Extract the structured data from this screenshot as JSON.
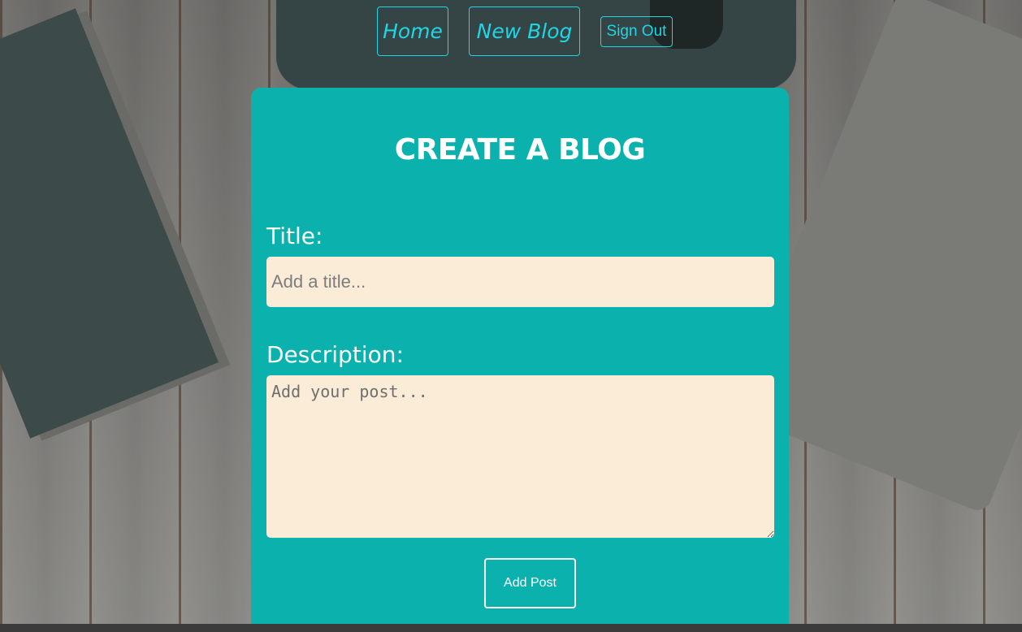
{
  "nav": {
    "home_label": "Home",
    "new_blog_label": "New Blog",
    "sign_out_label": "Sign Out"
  },
  "form": {
    "heading": "CREATE A BLOG",
    "title_label": "Title:",
    "title_placeholder": "Add a title...",
    "title_value": "",
    "description_label": "Description:",
    "description_placeholder": "Add your post...",
    "description_value": "",
    "submit_label": "Add Post"
  },
  "colors": {
    "card_background": "#0ab1ad",
    "nav_accent": "#1fd6e6",
    "input_background": "#fbecd8",
    "text_on_card": "#ffffff"
  }
}
